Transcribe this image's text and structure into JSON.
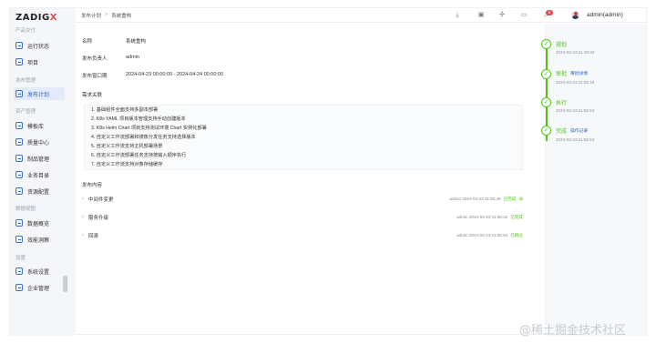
{
  "logo": {
    "text": "ZADIG",
    "accent": "X"
  },
  "sidebar": {
    "sections": {
      "product": "产品交付",
      "release": "发布管理",
      "assets": "资产管理",
      "data": "数据视图",
      "settings": "设置"
    },
    "items": [
      {
        "label": "运行状态"
      },
      {
        "label": "项目"
      },
      {
        "label": "发布计划"
      },
      {
        "label": "模板库"
      },
      {
        "label": "质量中心"
      },
      {
        "label": "制品管理"
      },
      {
        "label": "业务目录"
      },
      {
        "label": "资源配置"
      },
      {
        "label": "数据概览"
      },
      {
        "label": "效能洞察"
      },
      {
        "label": "系统设置"
      },
      {
        "label": "企业管理"
      }
    ]
  },
  "topbar": {
    "breadcrumb_root": "发布计划",
    "breadcrumb_sep": ">",
    "breadcrumb_current": "系统重构",
    "notification_count": "6",
    "user": "admin(admin)"
  },
  "plan": {
    "name_label": "名称",
    "name_value": "系统重构",
    "owner_label": "发布负责人",
    "owner_value": "admin",
    "window_label": "发布窗口期",
    "window_value": "2024-04-23 00:00:00 - 2024-04-24 00:00:00",
    "requirements_title": "需求关联",
    "requirements": [
      "1. 基础组件全面支持多副本部署",
      "2. K8s YAML 项目版本管理支持手动创建版本",
      "3. K8s Helm Chart 项目支持测试环境 Chart 实例化部署",
      "4. 自定义工作流部署和镜像分发任务支持选择版本",
      "5. 自定义工作流支持主机部署场景",
      "6. 自定义工作流部署任务支持按输入顺序执行",
      "7. 自定义工作流支持对象存储缓存"
    ],
    "content_title": "发布内容",
    "content": [
      {
        "name": "中间件变更",
        "meta": "admin 2024-04-23 11:55:46",
        "status": "已完成",
        "extra": "详"
      },
      {
        "name": "服务升级",
        "meta": "admin 2024-04-23 11:56:32",
        "status": "已完成",
        "extra": ""
      },
      {
        "name": "回滚",
        "meta": "admin 2024-04-23 11:56:54",
        "status": "已跳过",
        "extra": ""
      }
    ]
  },
  "timeline": [
    {
      "title": "规划",
      "link": "",
      "time": "2024-04-23 11:48:34"
    },
    {
      "title": "审批",
      "link": "审批详情",
      "time": "2024-04-23 11:55:16"
    },
    {
      "title": "执行",
      "link": "",
      "time": "2024-04-23 11:56:54"
    },
    {
      "title": "完成",
      "link": "操作记录",
      "time": "2024-04-23 11:56:54"
    }
  ],
  "watermark": "@稀土掘金技术社区",
  "colors": {
    "accent": "#2f62d1",
    "success": "#52c41a",
    "badge": "#e24c4c",
    "logo_x": "#e04b4b"
  }
}
